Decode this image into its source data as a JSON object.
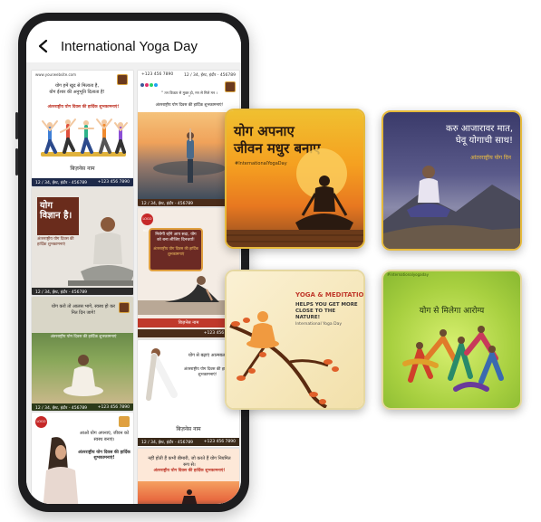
{
  "app_bar": {
    "title": "International Yoga Day",
    "back_icon": "arrow-left-icon"
  },
  "feed": {
    "card1": {
      "header": "www.yourwebsite.com",
      "text": "योग हमें खुद से मिलाता है,\nयोग ईश्वर की अनुभूति दिलाता है!",
      "heading": "अंतरराष्ट्रीय योग दिवस की हार्दिक शुभकामनाएं!",
      "business": "बिज़नेस नाम",
      "address": "12 / 34, ईस्ट, इंदौर - 456789",
      "phone": "+123 456 7890"
    },
    "card2": {
      "phone": "+123 456 7890",
      "address": "12 / 34, ईस्ट, इंदौर - 456789",
      "quote": "“ तन विकार से मुक्त हो, मन से मिले मन । ”",
      "heading": "अंतरराष्ट्रीय योग दिवस की हार्दिक शुभकामनाएं!",
      "footer": "12 / 34, ईस्ट, इंदौर - 456789"
    },
    "card3": {
      "title": "योग विज्ञान है।",
      "subtitle": "अंतरराष्ट्रीय योग दिवस की हार्दिक शुभकामनाएं",
      "footer": "12 / 34, ईस्ट, इंदौर - 456789"
    },
    "card4": {
      "logo": "LOGO HERE",
      "text": "निरोगी रहेंगे आप सदा, योग को बना लीजिए दिनचर्या!",
      "heading": "अंतरराष्ट्रीय योग दिवस की हार्दिक शुभकामनाएं",
      "banner": "बिज़नेस नाम",
      "footer": "+123 456 7890"
    },
    "card5": {
      "text": "योग करो तो आलस भागे, स्वस्थ हो कर नित दिन जागे!",
      "heading": "अंतरराष्ट्रीय योग दिवस की हार्दिक शुभकामनाएं",
      "footer": "12 / 34, ईस्ट, इंदौर - 456789",
      "phone": "+123 456 7890"
    },
    "card6": {
      "text": "योग से बढ़ाएं आत्मबल,",
      "heading": "अंतरराष्ट्रीय योग दिवस की हार्दिक शुभकामनाएं!",
      "business": "बिज़नेस नाम",
      "footer": "12 / 34, ईस्ट, इंदौर - 456789",
      "phone": "+123 456 7890"
    },
    "card7": {
      "logo": "LOGO",
      "text": "आओ योग अपनाएं, जीवन को स्वस्थ बनाएं।",
      "heading": "अंतरराष्ट्रीय योग दिवस की हार्दिक शुभकामनाएं!"
    },
    "card8": {
      "text": "नहीं होती हैं कभी बीमारी, जो करते हैं योग नियमित रूप से।",
      "heading": "अंतरराष्ट्रीय योग दिवस की हार्दिक शुभकामनाएं!"
    }
  },
  "posts": {
    "sunset": {
      "headline_line1": "योग अपनाए",
      "headline_line2": "जीवन मधुर बनाए",
      "hashtag": "#InternationalYogaDay"
    },
    "mountain": {
      "headline_line1": "करु आजारावर मात,",
      "headline_line2": "घेवू योगाची साथ!",
      "subtitle": "आंतरराष्ट्रीय योग दिन"
    },
    "meditation": {
      "title": "YOGA & MEDITATION",
      "text": "HELPS YOU GET MORE CLOSE TO THE NATURE!",
      "caption": "International Yoga Day"
    },
    "green": {
      "tag": "#internationalyogaday",
      "headline": "योग से मिलेगा आरोग्य"
    }
  },
  "colors": {
    "phone_body": "#1d1d1f",
    "accent_red": "#c0392b",
    "post_border": "#e6b93a"
  }
}
